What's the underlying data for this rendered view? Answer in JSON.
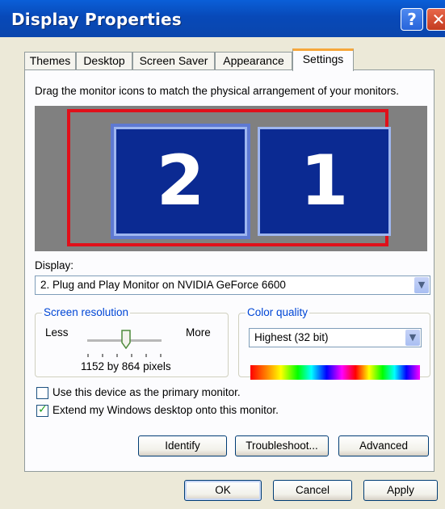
{
  "window": {
    "title": "Display Properties",
    "help_glyph": "?",
    "close_glyph": "✕"
  },
  "tabs": [
    "Themes",
    "Desktop",
    "Screen Saver",
    "Appearance",
    "Settings"
  ],
  "active_tab": "Settings",
  "settings": {
    "instruction": "Drag the monitor icons to match the physical arrangement of your monitors.",
    "monitors": [
      "2",
      "1"
    ],
    "display_label": "Display:",
    "display_value": "2. Plug and Play Monitor on NVIDIA GeForce 6600",
    "resolution": {
      "title": "Screen resolution",
      "less": "Less",
      "more": "More",
      "value_text": "1152 by 864 pixels",
      "slider_position": 0.55
    },
    "color_quality": {
      "title": "Color quality",
      "value": "Highest (32 bit)"
    },
    "primary_checkbox": {
      "label": "Use this device as the primary monitor.",
      "checked": false
    },
    "extend_checkbox": {
      "label": "Extend my Windows desktop onto this monitor.",
      "checked": true,
      "mark": "✓"
    },
    "buttons": {
      "identify": "Identify",
      "troubleshoot": "Troubleshoot...",
      "advanced": "Advanced"
    }
  },
  "footer": {
    "ok": "OK",
    "cancel": "Cancel",
    "apply": "Apply"
  },
  "colors": {
    "title_bar": "#0849b8",
    "monitor_fill": "#0b2a92",
    "selection_border": "#e0101a",
    "group_title": "#0046d5"
  }
}
